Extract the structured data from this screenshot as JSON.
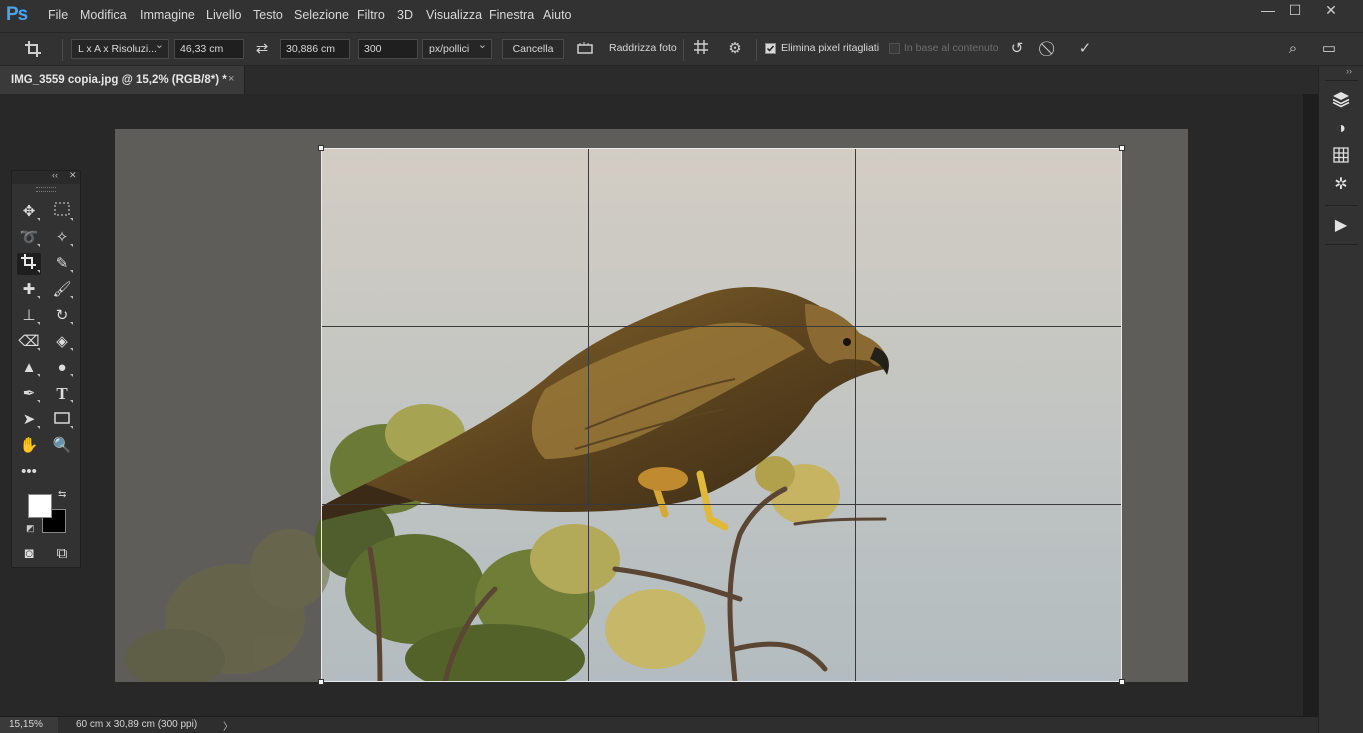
{
  "app": {
    "logo": "Ps"
  },
  "menu": [
    "File",
    "Modifica",
    "Immagine",
    "Livello",
    "Testo",
    "Selezione",
    "Filtro",
    "3D",
    "Visualizza",
    "Finestra",
    "Aiuto"
  ],
  "window_controls": {
    "minimize": "—",
    "maximize": "☐",
    "close": "✕"
  },
  "options": {
    "preset": "L x A x Risoluzi...",
    "width": "46,33 cm",
    "height": "30,886 cm",
    "resolution": "300",
    "units": "px/pollici",
    "clear_label": "Cancella",
    "straighten_label": "Raddrizza foto",
    "delete_cropped_label": "Elimina pixel ritagliati",
    "delete_cropped_checked": true,
    "content_aware_label": "In base al contenuto",
    "content_aware_checked": false
  },
  "document": {
    "tab_title": "IMG_3559 copia.jpg @ 15,2% (RGB/8*) *",
    "close_glyph": "×"
  },
  "status": {
    "zoom": "15,15%",
    "doc_size": "60 cm x 30,89 cm (300 ppi)",
    "arrow": "〉"
  },
  "toolbox": {
    "active_tool": "crop-tool",
    "foreground_color": "#ffffff",
    "background_color": "#000000"
  },
  "right_panels": [
    "layers-icon",
    "adjustments-icon",
    "swatches-icon",
    "navigator-icon",
    "play-action-icon"
  ]
}
